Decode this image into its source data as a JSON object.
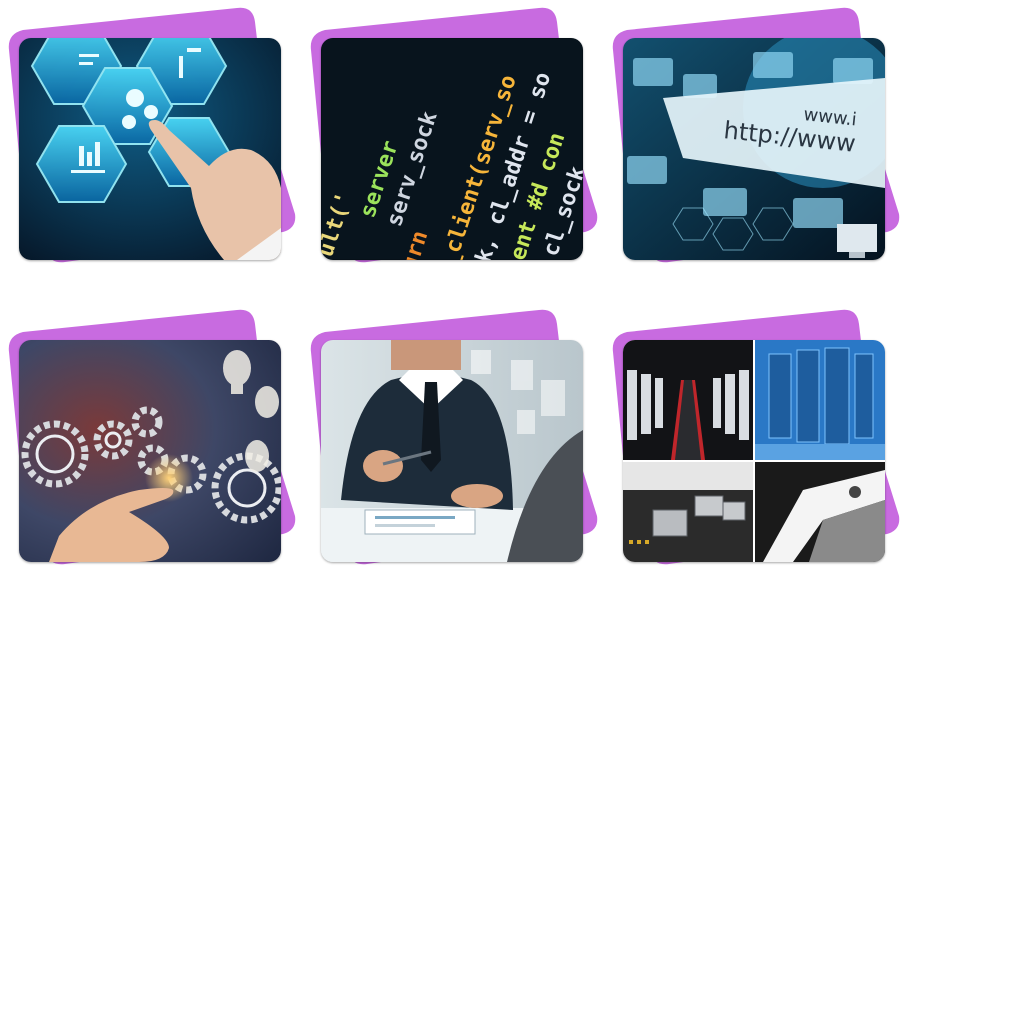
{
  "page": {
    "background": "#ffffff",
    "accent_shape_color": "#c86be0"
  },
  "gallery": {
    "tiles": [
      {
        "icon": "hexagon-tech-touch-icon",
        "theme": "#0a2a4a"
      },
      {
        "icon": "source-code-icon",
        "theme": "#0b1a24",
        "code_lines": [
          "ult('",
          "server",
          "serv_sock",
          "turn",
          "ent_client(serv_so",
          "_sock, cl_addr = so",
          "('client #d con",
          "cl_sock"
        ]
      },
      {
        "icon": "internet-globe-icon",
        "theme": "#0f3550",
        "code_lines": [
          "http://www",
          "www.i"
        ]
      },
      {
        "icon": "gears-lightbulb-icon",
        "theme": "#3a4460"
      },
      {
        "icon": "business-meeting-icon",
        "theme": "#c9d6dd"
      },
      {
        "icon": "server-hardware-collage-icon",
        "theme": "#1c1f24"
      }
    ]
  }
}
